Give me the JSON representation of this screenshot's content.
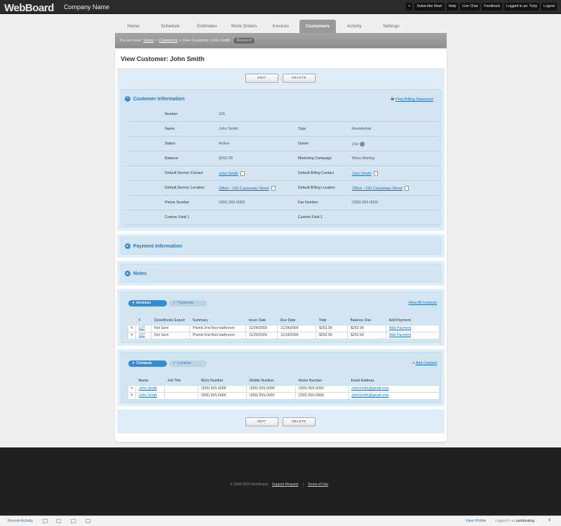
{
  "app": {
    "logo": "WebBoard",
    "company": "Company Name"
  },
  "toplinks": [
    "+",
    "Subscribe Now!",
    "Help",
    "Live Chat",
    "Feedback",
    "Logged in as: Yuriy",
    "Logout"
  ],
  "nav": {
    "tabs": [
      "Home",
      "Schedule",
      "Estimates",
      "Work Orders",
      "Invoices",
      "Customers",
      "Activity",
      "Settings"
    ],
    "active": "Customers"
  },
  "breadcrumb": {
    "prefix": "You are here:",
    "home": "Home",
    "customers": "Customers",
    "current": "View Customer: John Smith",
    "recent": "Recent"
  },
  "page": {
    "title": "View Customer: John Smith"
  },
  "buttons": {
    "edit": "EDIT",
    "delete": "DELETE"
  },
  "customer_info": {
    "title": "Customer Information",
    "print_link": "Print Billing Statement",
    "number_label": "Number",
    "number": "101",
    "name_label": "Name",
    "name": "John Smith",
    "type_label": "Type",
    "type": "Residential",
    "status_label": "Status",
    "status": "Active",
    "owner_label": "Owner",
    "owner": "Zvir",
    "balance_label": "Balance",
    "balance": "$252.99",
    "marketing_label": "Marketing Campaign",
    "marketing": "Mass Mailing",
    "service_contact_label": "Default Service Contact",
    "service_contact": "John Smith",
    "billing_contact_label": "Default Billing Contact",
    "billing_contact": "John Smith",
    "service_location_label": "Default Service Location",
    "service_location": "Office - 150 Causeway Street",
    "billing_location_label": "Default Billing Location",
    "billing_location": "Office - 150 Causeway Street",
    "phone_label": "Phone Number",
    "phone": "(555) 555 0000",
    "fax_label": "Fax Number",
    "fax": "(555) 555 0000",
    "custom1_label": "Custom Field 1",
    "custom2_label": "Custom Field 2"
  },
  "payment_info": {
    "title": "Payment Information"
  },
  "notes": {
    "title": "Notes"
  },
  "invoices": {
    "tab_on": "Invoices",
    "tab_off": "Payments",
    "view_all": "View All Invoices",
    "headers": [
      "#",
      "QuickBooks Export",
      "Summary",
      "Issue Date",
      "Due Date",
      "Total",
      "Balance Due",
      "Add Payment"
    ],
    "rows": [
      [
        "107",
        "Not Sent",
        "Plumb 2nd floor bathroom",
        "11/24/2009",
        "11/24/2009",
        "$262.99",
        "$262.99",
        "Add Payment"
      ],
      [
        "107",
        "Not Sent",
        "Plumb 2nd floor bathroom",
        "11/24/2009",
        "11/24/2009",
        "$262.99",
        "$262.99",
        "Add Payment"
      ]
    ]
  },
  "contacts": {
    "tab_on": "Contacts",
    "tab_off": "Location",
    "add": "Add Contact",
    "headers": [
      "Name",
      "Job Title",
      "Work Number",
      "Mobile Number",
      "Home Number",
      "Email Address"
    ],
    "rows": [
      [
        "John Smith",
        "",
        "(555) 555-0000",
        "(555) 555-0000",
        "(555) 555-0000",
        "JohnSmith@gmail.com"
      ],
      [
        "John Smith",
        "",
        "(555) 555-0000",
        "(555) 555-0000",
        "(555) 555-0000",
        "JohnSmith@gmail.com"
      ]
    ]
  },
  "footer": {
    "copyright": "© 2008-2009 WebBoard",
    "support": "Support Request",
    "terms": "Terms of Use"
  },
  "bottombar": {
    "recent_activity": "Recent Activity",
    "view_profile": "View Profile",
    "logged_label": "Logged in as",
    "user": "parkheating",
    "close": "x"
  }
}
